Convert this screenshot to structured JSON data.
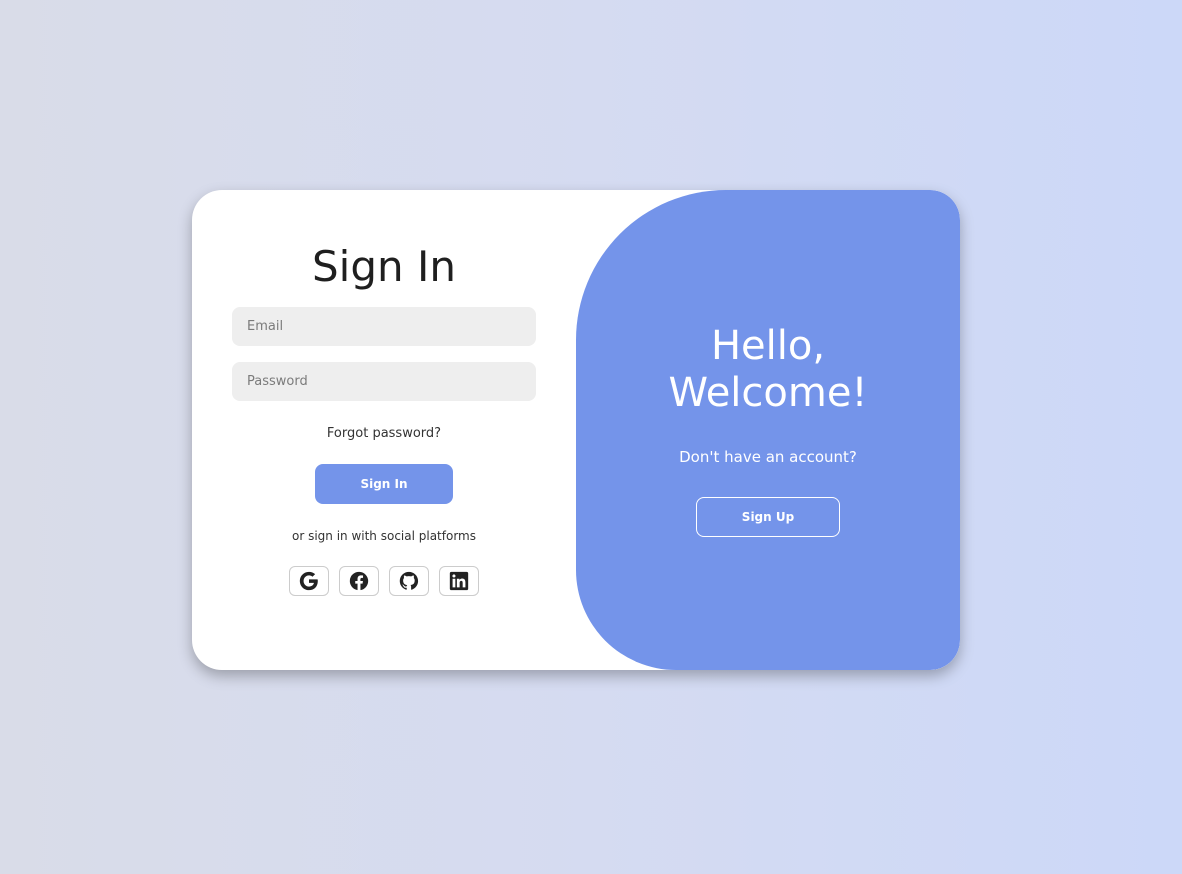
{
  "sign_in": {
    "title": "Sign In",
    "email_placeholder": "Email",
    "password_placeholder": "Password",
    "forgot_password": "Forgot password?",
    "button_label": "Sign In",
    "social_text": "or sign in with social platforms",
    "social_icons": [
      "google-icon",
      "facebook-icon",
      "github-icon",
      "linkedin-icon"
    ]
  },
  "welcome": {
    "line1": "Hello,",
    "line2": "Welcome!",
    "prompt": "Don't have an account?",
    "button_label": "Sign Up"
  },
  "colors": {
    "accent": "#7494ea",
    "card_bg": "#ffffff",
    "input_bg": "#eeeeee"
  }
}
